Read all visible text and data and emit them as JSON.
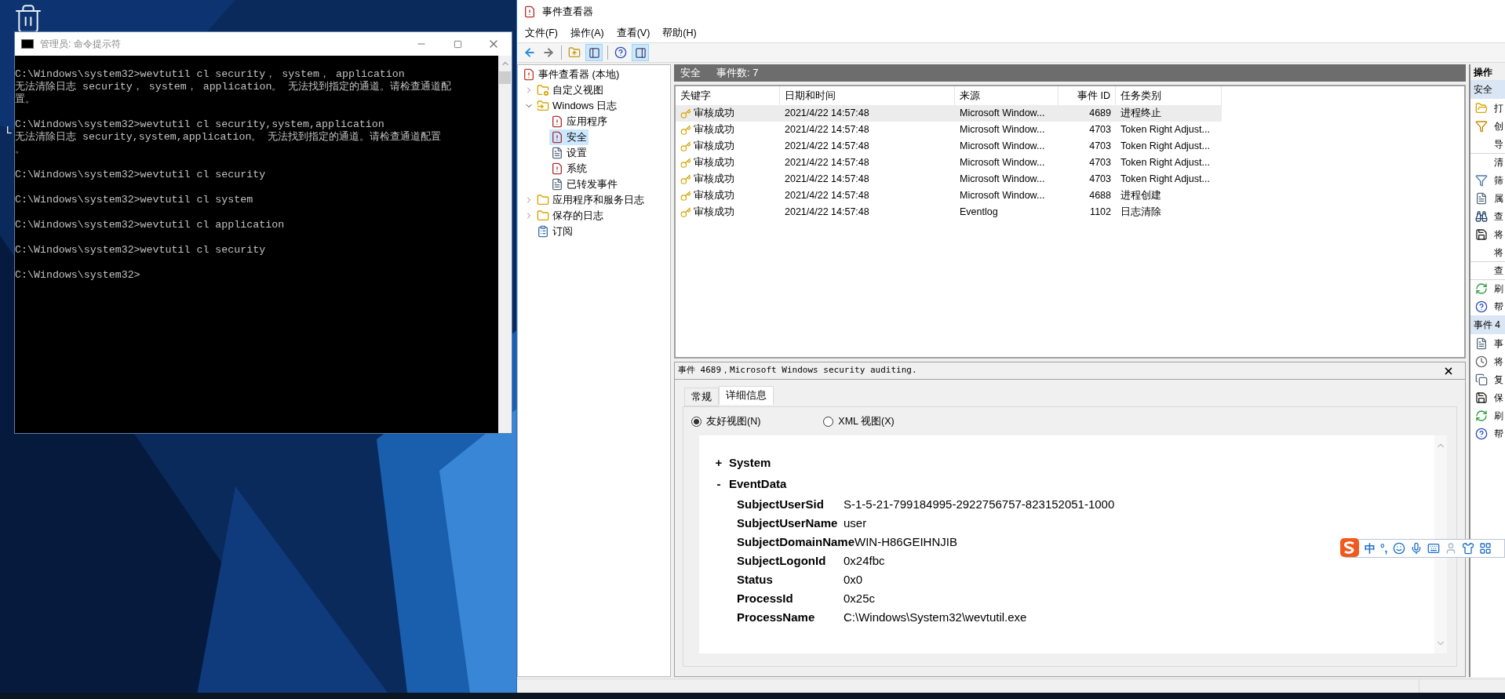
{
  "desktop": {
    "partial_label": "L"
  },
  "cmd_window": {
    "title": "管理员: 命令提示符",
    "blocks": [
      {
        "lines": [
          "C:\\Windows\\system32>wevtutil cl security， system， application",
          "无法清除日志 security， system， application。 无法找到指定的通道。请检查通道配",
          "置。"
        ]
      },
      {
        "lines": [
          "C:\\Windows\\system32>wevtutil cl security,system,application",
          "无法清除日志 security,system,application。 无法找到指定的通道。请检查通道配置",
          "。"
        ]
      },
      {
        "lines": [
          "C:\\Windows\\system32>wevtutil cl security"
        ]
      },
      {
        "lines": [
          "C:\\Windows\\system32>wevtutil cl system"
        ]
      },
      {
        "lines": [
          "C:\\Windows\\system32>wevtutil cl application"
        ]
      },
      {
        "lines": [
          "C:\\Windows\\system32>wevtutil cl security"
        ]
      },
      {
        "lines": [
          "C:\\Windows\\system32>"
        ]
      }
    ]
  },
  "event_viewer": {
    "title": "事件查看器",
    "menu": [
      "文件(F)",
      "操作(A)",
      "查看(V)",
      "帮助(H)"
    ],
    "tree": [
      {
        "label": "事件查看器 (本地)",
        "kind": "root",
        "selected": false,
        "children": [
          {
            "label": "自定义视图",
            "kind": "filter-folder",
            "expanded": false,
            "selected": false
          },
          {
            "label": "Windows 日志",
            "kind": "windows-folder",
            "expanded": true,
            "selected": false,
            "children": [
              {
                "label": "应用程序",
                "kind": "alert-log",
                "selected": false
              },
              {
                "label": "安全",
                "kind": "alert-log",
                "selected": true
              },
              {
                "label": "设置",
                "kind": "log",
                "selected": false
              },
              {
                "label": "系统",
                "kind": "alert-log",
                "selected": false
              },
              {
                "label": "已转发事件",
                "kind": "log",
                "selected": false
              }
            ]
          },
          {
            "label": "应用程序和服务日志",
            "kind": "folder",
            "expanded": false,
            "selected": false
          },
          {
            "label": "保存的日志",
            "kind": "folder",
            "expanded": false,
            "selected": false
          },
          {
            "label": "订阅",
            "kind": "subscription",
            "selected": false
          }
        ]
      }
    ],
    "list_header": {
      "name": "安全",
      "count": "事件数: 7"
    },
    "table": {
      "columns": [
        {
          "label": "关键字",
          "numeric": false
        },
        {
          "label": "日期和时间",
          "numeric": false
        },
        {
          "label": "来源",
          "numeric": false
        },
        {
          "label": "事件 ID",
          "numeric": true
        },
        {
          "label": "任务类别",
          "numeric": false
        }
      ],
      "rows": [
        {
          "keyword": "审核成功",
          "datetime": "2021/4/22 14:57:48",
          "source": "Microsoft Window...",
          "event_id": "4689",
          "task_category": "进程终止",
          "selected": true
        },
        {
          "keyword": "审核成功",
          "datetime": "2021/4/22 14:57:48",
          "source": "Microsoft Window...",
          "event_id": "4703",
          "task_category": "Token Right Adjust...",
          "selected": false
        },
        {
          "keyword": "审核成功",
          "datetime": "2021/4/22 14:57:48",
          "source": "Microsoft Window...",
          "event_id": "4703",
          "task_category": "Token Right Adjust...",
          "selected": false
        },
        {
          "keyword": "审核成功",
          "datetime": "2021/4/22 14:57:48",
          "source": "Microsoft Window...",
          "event_id": "4703",
          "task_category": "Token Right Adjust...",
          "selected": false
        },
        {
          "keyword": "审核成功",
          "datetime": "2021/4/22 14:57:48",
          "source": "Microsoft Window...",
          "event_id": "4703",
          "task_category": "Token Right Adjust...",
          "selected": false
        },
        {
          "keyword": "审核成功",
          "datetime": "2021/4/22 14:57:48",
          "source": "Microsoft Window...",
          "event_id": "4688",
          "task_category": "进程创建",
          "selected": false
        },
        {
          "keyword": "审核成功",
          "datetime": "2021/4/22 14:57:48",
          "source": "Eventlog",
          "event_id": "1102",
          "task_category": "日志清除",
          "selected": false
        }
      ]
    },
    "detail": {
      "title": "事件 4689，Microsoft Windows security auditing.",
      "tabs": [
        {
          "label": "常规",
          "selected": false
        },
        {
          "label": "详细信息",
          "selected": true
        }
      ],
      "views": [
        {
          "label": "友好视图(N)",
          "selected": true
        },
        {
          "label": "XML 视图(X)",
          "selected": false
        }
      ],
      "sections": [
        {
          "toggle": "+",
          "name": "System"
        },
        {
          "toggle": "-",
          "name": "EventData",
          "fields": [
            {
              "key": "SubjectUserSid",
              "value": "S-1-5-21-799184995-2922756757-823152051-1000"
            },
            {
              "key": "SubjectUserName",
              "value": "user"
            },
            {
              "key": "SubjectDomainName",
              "value": "WIN-H86GEIHNJIB"
            },
            {
              "key": "SubjectLogonId",
              "value": "0x24fbc"
            },
            {
              "key": "Status",
              "value": "0x0"
            },
            {
              "key": "ProcessId",
              "value": "0x25c"
            },
            {
              "key": "ProcessName",
              "value": "C:\\Windows\\System32\\wevtutil.exe"
            }
          ]
        }
      ]
    },
    "actions": {
      "title": "操作",
      "groups": [
        {
          "header": "安全",
          "items": [
            {
              "label": "打",
              "kind": "open",
              "divider_before": false
            },
            {
              "label": "创",
              "kind": "filter-new",
              "divider_before": false
            },
            {
              "label": "导",
              "kind": "plain",
              "divider_before": false
            },
            {
              "label": "清",
              "kind": "plain",
              "divider_before": true
            },
            {
              "label": "筛",
              "kind": "filter",
              "divider_before": false
            },
            {
              "label": "属",
              "kind": "properties",
              "divider_before": false
            },
            {
              "label": "查",
              "kind": "find",
              "divider_before": false
            },
            {
              "label": "将",
              "kind": "save",
              "divider_before": false
            },
            {
              "label": "将",
              "kind": "plain",
              "divider_before": false
            },
            {
              "label": "查",
              "kind": "plain",
              "divider_before": true
            },
            {
              "label": "刷",
              "kind": "refresh",
              "divider_before": true
            },
            {
              "label": "帮",
              "kind": "help",
              "divider_before": false
            }
          ]
        },
        {
          "header": "事件 4",
          "items": [
            {
              "label": "事",
              "kind": "properties",
              "divider_before": false
            },
            {
              "label": "将",
              "kind": "task",
              "divider_before": false
            },
            {
              "label": "复",
              "kind": "copy",
              "divider_before": false
            },
            {
              "label": "保",
              "kind": "save",
              "divider_before": false
            },
            {
              "label": "刷",
              "kind": "refresh",
              "divider_before": false
            },
            {
              "label": "帮",
              "kind": "help",
              "divider_before": false
            }
          ]
        }
      ]
    }
  },
  "ime_toolbar": {
    "mode": "中",
    "punctuation": "°,"
  }
}
